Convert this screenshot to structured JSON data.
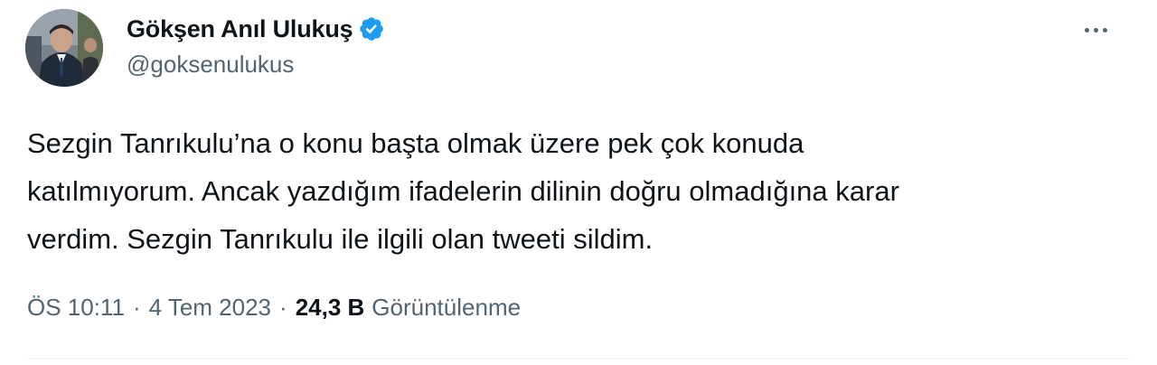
{
  "author": {
    "name": "Gökşen Anıl Ulukuş",
    "handle": "@goksenulukus",
    "verified": true
  },
  "tweet": {
    "lines": [
      "Sezgin Tanrıkulu’na o konu başta olmak üzere pek çok konuda",
      "katılmıyorum. Ancak yazdığım ifadelerin dilinin doğru olmadığına karar",
      "verdim. Sezgin Tanrıkulu ile ilgili olan tweeti sildim."
    ]
  },
  "meta": {
    "time": "ÖS 10:11",
    "separator": "·",
    "date": "4 Tem 2023",
    "views_count": "24,3 B",
    "views_label": "Görüntülenme"
  },
  "icons": {
    "verified": "verified-badge-icon",
    "more": "more-options-icon"
  },
  "colors": {
    "text_primary": "#0f1419",
    "text_secondary": "#536471",
    "verified_blue": "#1d9bf0",
    "divider": "#eff3f4"
  }
}
